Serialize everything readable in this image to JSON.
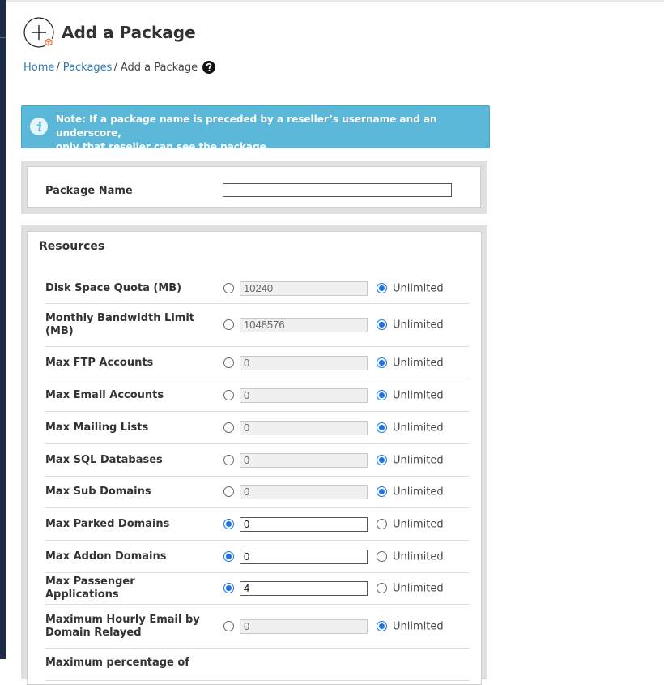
{
  "page": {
    "title": "Add a Package",
    "breadcrumb": {
      "home": "Home",
      "sep1": "/",
      "packages": "Packages",
      "sep2": "/",
      "current": "Add a Package"
    }
  },
  "note": {
    "line1": "Note: If a package name is preceded by a reseller’s username and an underscore,",
    "line2": "only that reseller can see the package."
  },
  "package_name": {
    "label": "Package Name",
    "value": ""
  },
  "resources": {
    "title": "Resources",
    "unlimited_label": "Unlimited",
    "rows": [
      {
        "label": "Disk Space Quota (MB)",
        "value": "10240",
        "selected": "unlimited"
      },
      {
        "label": "Monthly Bandwidth Limit (MB)",
        "value": "1048576",
        "selected": "unlimited"
      },
      {
        "label": "Max FTP Accounts",
        "value": "0",
        "selected": "unlimited"
      },
      {
        "label": "Max Email Accounts",
        "value": "0",
        "selected": "unlimited"
      },
      {
        "label": "Max Mailing Lists",
        "value": "0",
        "selected": "unlimited"
      },
      {
        "label": "Max SQL Databases",
        "value": "0",
        "selected": "unlimited"
      },
      {
        "label": "Max Sub Domains",
        "value": "0",
        "selected": "unlimited"
      },
      {
        "label": "Max Parked Domains",
        "value": "0",
        "selected": "value"
      },
      {
        "label": "Max Addon Domains",
        "value": "0",
        "selected": "value"
      },
      {
        "label": "Max Passenger Applications",
        "value": "4",
        "selected": "value"
      },
      {
        "label": "Maximum Hourly Email by Domain Relayed",
        "value": "0",
        "selected": "unlimited"
      },
      {
        "label": "Maximum percentage of",
        "value": "",
        "selected": "none"
      }
    ]
  },
  "colors": {
    "accent": "#1a73e8",
    "note_bg": "#5bb8d9",
    "link": "#2a7ab4",
    "rail": "#1e2a4a"
  },
  "icons": {
    "page": "add-package-icon",
    "help": "help-icon",
    "note": "info-icon"
  }
}
